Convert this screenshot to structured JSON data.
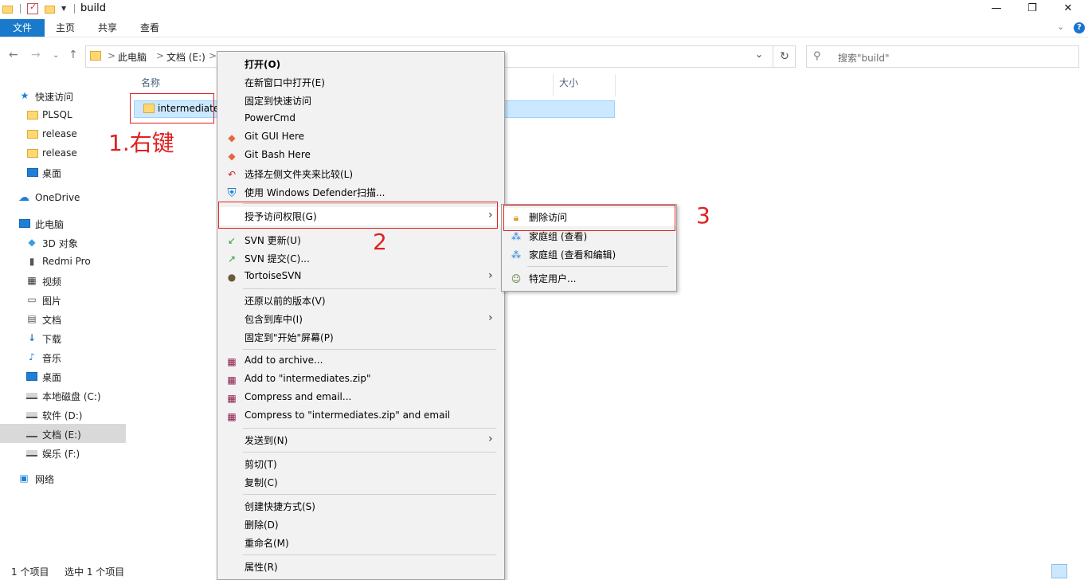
{
  "window": {
    "title": "build",
    "minimize": "—",
    "maximize": "❐",
    "close": "✕"
  },
  "ribbon": {
    "tabs": [
      "文件",
      "主页",
      "共享",
      "查看"
    ]
  },
  "address": {
    "crumbs": [
      "此电脑",
      "文档 (E:)"
    ],
    "separator": ">"
  },
  "search": {
    "placeholder": "搜索\"build\""
  },
  "sidebar": {
    "items": [
      {
        "label": "快速访问",
        "icon": "star-icon"
      },
      {
        "label": "PLSQL",
        "icon": "folder-icon"
      },
      {
        "label": "release",
        "icon": "folder-icon"
      },
      {
        "label": "release",
        "icon": "folder-icon"
      },
      {
        "label": "桌面",
        "icon": "desktop-icon"
      },
      {
        "label": "OneDrive",
        "icon": "cloud-icon"
      },
      {
        "label": "此电脑",
        "icon": "computer-icon"
      },
      {
        "label": "3D 对象",
        "icon": "cube-icon"
      },
      {
        "label": "Redmi Pro",
        "icon": "phone-icon"
      },
      {
        "label": "视频",
        "icon": "film-icon"
      },
      {
        "label": "图片",
        "icon": "picture-icon"
      },
      {
        "label": "文档",
        "icon": "document-icon"
      },
      {
        "label": "下载",
        "icon": "download-icon"
      },
      {
        "label": "音乐",
        "icon": "music-icon"
      },
      {
        "label": "桌面",
        "icon": "desktop-icon"
      },
      {
        "label": "本地磁盘 (C:)",
        "icon": "drive-icon"
      },
      {
        "label": "软件 (D:)",
        "icon": "drive-icon"
      },
      {
        "label": "文档 (E:)",
        "icon": "drive-icon"
      },
      {
        "label": "娱乐 (F:)",
        "icon": "drive-icon"
      },
      {
        "label": "网络",
        "icon": "network-icon"
      }
    ]
  },
  "columns": {
    "name": "名称",
    "size": "大小"
  },
  "files": [
    {
      "name": "intermediate"
    }
  ],
  "annotations": {
    "step1": "1.右键",
    "step2": "2",
    "step3": "3"
  },
  "context_menu": {
    "items": [
      "打开(O)",
      "在新窗口中打开(E)",
      "固定到快速访问",
      "PowerCmd",
      "Git GUI Here",
      "Git Bash Here",
      "选择左侧文件夹来比较(L)",
      "使用 Windows Defender扫描...",
      "授予访问权限(G)",
      "SVN 更新(U)",
      "SVN 提交(C)...",
      "TortoiseSVN",
      "还原以前的版本(V)",
      "包含到库中(I)",
      "固定到\"开始\"屏幕(P)",
      "Add to archive...",
      "Add to \"intermediates.zip\"",
      "Compress and email...",
      "Compress to \"intermediates.zip\" and email",
      "发送到(N)",
      "剪切(T)",
      "复制(C)",
      "创建快捷方式(S)",
      "删除(D)",
      "重命名(M)",
      "属性(R)"
    ]
  },
  "submenu": {
    "items": [
      "删除访问",
      "家庭组 (查看)",
      "家庭组 (查看和编辑)",
      "特定用户..."
    ]
  },
  "status": {
    "count": "1 个项目",
    "selected": "选中 1 个项目"
  }
}
